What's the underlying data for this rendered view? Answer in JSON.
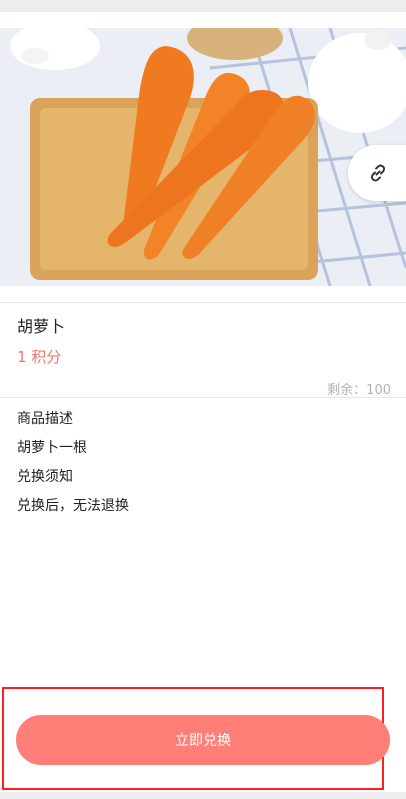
{
  "product": {
    "name": "胡萝卜",
    "points": "1 积分",
    "stock": "剩余：100"
  },
  "details": {
    "desc_heading": "商品描述",
    "desc_text": "胡萝卜一根",
    "notice_heading": "兑换须知",
    "notice_text": "兑换后，无法退换"
  },
  "actions": {
    "redeem_label": "立即兑换",
    "share_icon": "link-icon"
  },
  "colors": {
    "accent": "#ff7f78",
    "points_text": "#f07575",
    "highlight": "#ff1f1f"
  }
}
